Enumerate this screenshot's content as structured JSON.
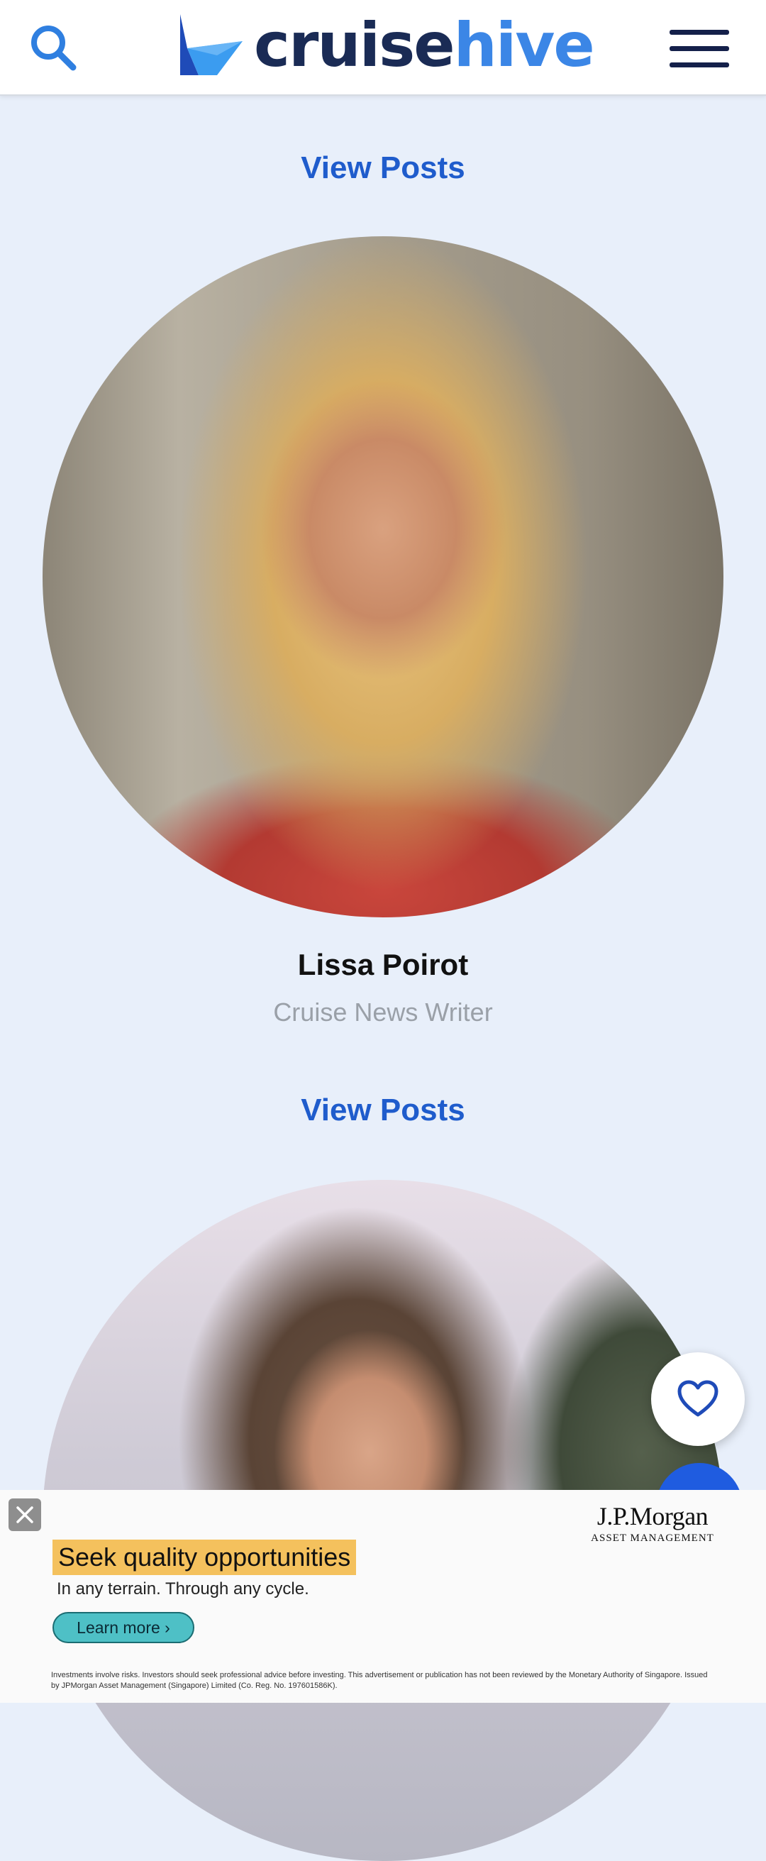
{
  "header": {
    "logo_part1": "cruise",
    "logo_part2": "hive",
    "search_icon": "search-icon",
    "menu_icon": "hamburger-menu-icon"
  },
  "authors": [
    {
      "view_posts_label": "View Posts"
    },
    {
      "name": "Lissa Poirot",
      "role": "Cruise News Writer",
      "view_posts_label": "View Posts"
    }
  ],
  "floating": {
    "favorite_icon": "heart-icon"
  },
  "ad": {
    "brand_line1": "J.P.Morgan",
    "brand_line2": "ASSET MANAGEMENT",
    "headline": "Seek quality opportunities",
    "subline": "In any terrain. Through any cycle.",
    "cta_label": "Learn more",
    "disclaimer": "Investments involve risks. Investors should seek professional advice before investing. This advertisement or publication has not been reviewed by the Monetary Authority of Singapore. Issued by JPMorgan Asset Management (Singapore) Limited (Co. Reg. No. 197601586K).",
    "close_icon": "close-icon"
  },
  "colors": {
    "page_bg": "#e8effa",
    "link_blue": "#1f5ccc",
    "logo_dark": "#1a2b55",
    "logo_light": "#3b86e6",
    "ad_highlight": "#f4c15d",
    "ad_cta": "#4ec0c6"
  }
}
